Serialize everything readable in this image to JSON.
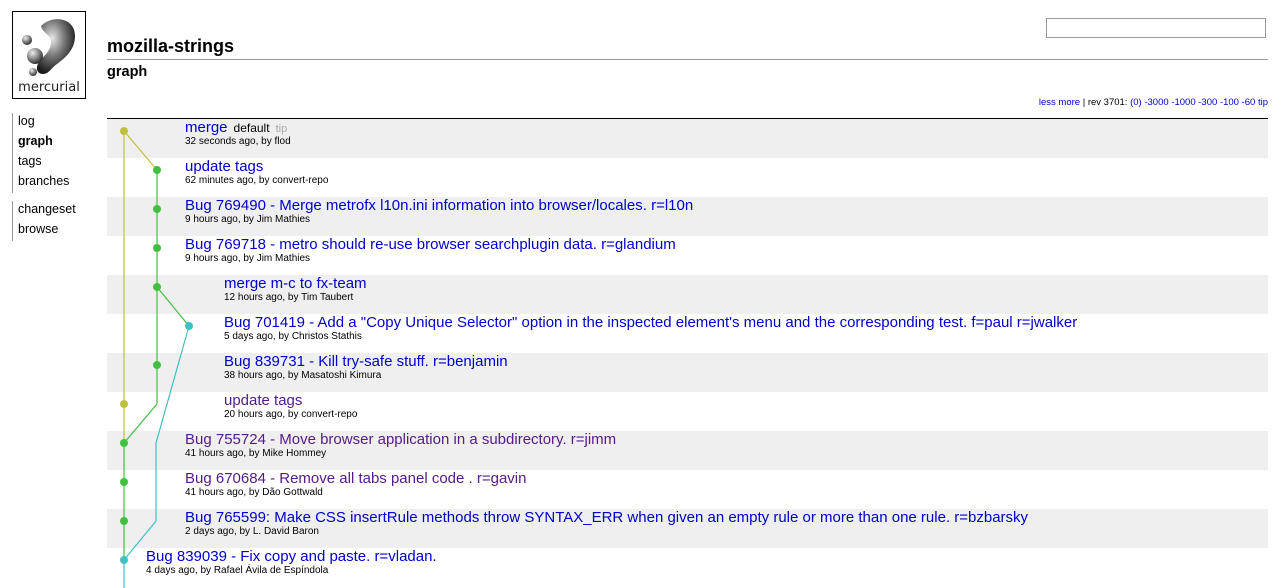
{
  "logo": {
    "text": "mercurial"
  },
  "nav": {
    "items_a": [
      {
        "label": "log",
        "active": false
      },
      {
        "label": "graph",
        "active": true
      },
      {
        "label": "tags",
        "active": false
      },
      {
        "label": "branches",
        "active": false
      }
    ],
    "items_b": [
      {
        "label": "changeset",
        "active": false
      },
      {
        "label": "browse",
        "active": false
      }
    ]
  },
  "header": {
    "title": "mozilla-strings",
    "subtitle": "graph"
  },
  "search": {
    "value": "",
    "placeholder": ""
  },
  "pager": {
    "less": "less",
    "more": "more",
    "sep": "|",
    "rev": "rev 3701:",
    "links": [
      "(0)",
      "-3000",
      "-1000",
      "-300",
      "-100",
      "-60",
      "tip"
    ]
  },
  "colors": {
    "yellow": "#c0c040",
    "green": "#40c040",
    "cyan": "#40c0c0",
    "link": "#0000cc",
    "visited": "#551a8b"
  },
  "changesets": [
    {
      "desc": "merge",
      "meta": "32 seconds ago, by flod",
      "branch": "default",
      "tip": "tip",
      "visited": false
    },
    {
      "desc": "update tags",
      "meta": "62 minutes ago, by convert-repo",
      "visited": false
    },
    {
      "desc": "Bug 769490 - Merge metrofx l10n.ini information into browser/locales. r=l10n",
      "meta": "9 hours ago, by Jim Mathies",
      "visited": false
    },
    {
      "desc": "Bug 769718 - metro should re-use browser searchplugin data. r=glandium",
      "meta": "9 hours ago, by Jim Mathies",
      "visited": false
    },
    {
      "desc": "merge m-c to fx-team",
      "meta": "12 hours ago, by Tim Taubert",
      "visited": false
    },
    {
      "desc": "Bug 701419 - Add a \"Copy Unique Selector\" option in the inspected element's menu and the corresponding test. f=paul r=jwalker",
      "meta": "5 days ago, by Christos Stathis",
      "visited": false
    },
    {
      "desc": "Bug 839731 - Kill try-safe stuff. r=benjamin",
      "meta": "38 hours ago, by Masatoshi Kimura",
      "visited": false
    },
    {
      "desc": "update tags",
      "meta": "20 hours ago, by convert-repo",
      "visited": true
    },
    {
      "desc": "Bug 755724 - Move browser application in a subdirectory. r=jimm",
      "meta": "41 hours ago, by Mike Hommey",
      "visited": true
    },
    {
      "desc": "Bug 670684 - Remove all tabs panel code . r=gavin",
      "meta": "41 hours ago, by Dão Gottwald",
      "visited": true
    },
    {
      "desc": "Bug 765599: Make CSS insertRule methods throw SYNTAX_ERR when given an empty rule or more than one rule. r=bzbarsky",
      "meta": "2 days ago, by L. David Baron",
      "visited": false
    },
    {
      "desc": "Bug 839039 - Fix copy and paste. r=vladan.",
      "meta": "4 days ago, by Rafael Ávila de Espíndola",
      "visited": false
    }
  ]
}
